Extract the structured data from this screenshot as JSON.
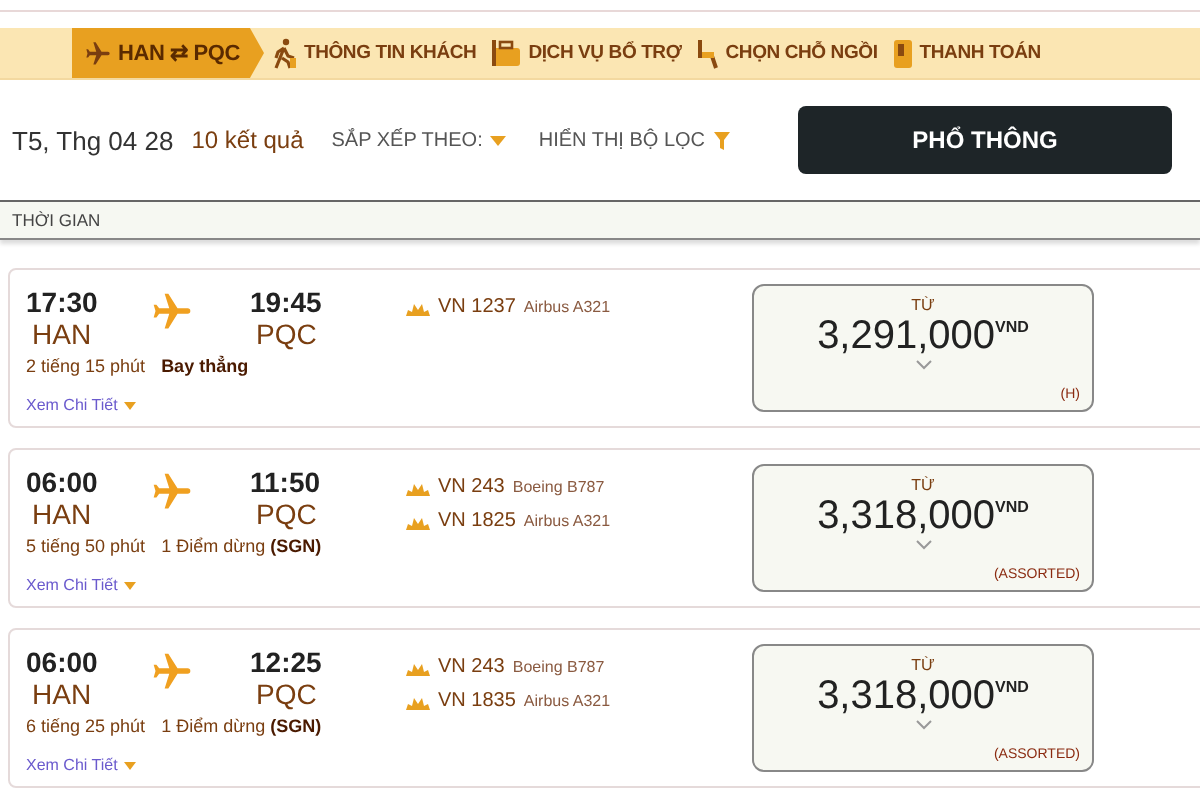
{
  "steps": [
    {
      "kind": "route",
      "label": "HAN ⇄ PQC",
      "selected": true
    },
    {
      "kind": "passenger",
      "label": "THÔNG TIN KHÁCH",
      "selected": false
    },
    {
      "kind": "services",
      "label": "DỊCH VỤ BỔ TRỢ",
      "selected": false
    },
    {
      "kind": "seat",
      "label": "CHỌN CHỖ NGỒI",
      "selected": false
    },
    {
      "kind": "payment",
      "label": "THANH TOÁN",
      "selected": false
    }
  ],
  "toolbar": {
    "date": "T5, Thg 04 28",
    "results": "10 kết quả",
    "sort_label": "SẮP XẾP THEO:",
    "filter_label": "HIỂN THỊ BỘ LỌC",
    "cabin_button": "PHỔ THÔNG"
  },
  "column_header": "THỜI GIAN",
  "flights": [
    {
      "depart_time": "17:30",
      "depart_code": "HAN",
      "arrive_time": "19:45",
      "arrive_code": "PQC",
      "duration": "2 tiếng 15 phút",
      "stops": "**Bay thẳng**",
      "legs": [
        {
          "flight": "VN 1237",
          "aircraft": "Airbus A321"
        }
      ],
      "details": "Xem Chi Tiết",
      "price_label": "TỪ",
      "price": "3,291,000",
      "currency": "VND",
      "fare_class": "(H)"
    },
    {
      "depart_time": "06:00",
      "depart_code": "HAN",
      "arrive_time": "11:50",
      "arrive_code": "PQC",
      "duration": "5 tiếng 50 phút",
      "stops": "1 Điểm dừng **(SGN)**",
      "legs": [
        {
          "flight": "VN 243",
          "aircraft": "Boeing B787"
        },
        {
          "flight": "VN 1825",
          "aircraft": "Airbus A321"
        }
      ],
      "details": "Xem Chi Tiết",
      "price_label": "TỪ",
      "price": "3,318,000",
      "currency": "VND",
      "fare_class": "(ASSORTED)"
    },
    {
      "depart_time": "06:00",
      "depart_code": "HAN",
      "arrive_time": "12:25",
      "arrive_code": "PQC",
      "duration": "6 tiếng 25 phút",
      "stops": "1 Điểm dừng **(SGN)**",
      "legs": [
        {
          "flight": "VN 243",
          "aircraft": "Boeing B787"
        },
        {
          "flight": "VN 1835",
          "aircraft": "Airbus A321"
        }
      ],
      "details": "Xem Chi Tiết",
      "price_label": "TỪ",
      "price": "3,318,000",
      "currency": "VND",
      "fare_class": "(ASSORTED)"
    }
  ]
}
